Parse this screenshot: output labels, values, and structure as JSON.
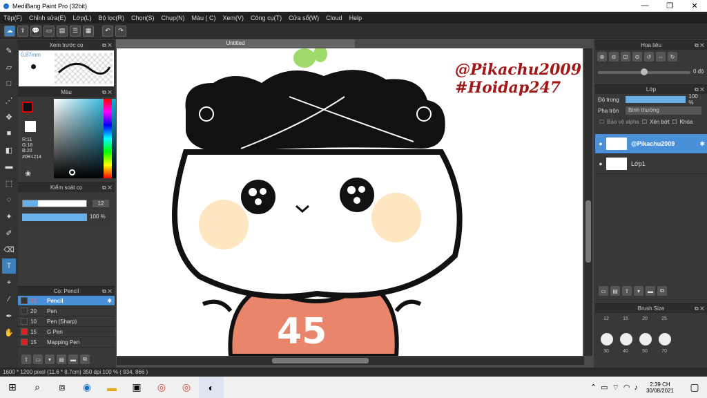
{
  "window": {
    "title": "MediBang Paint Pro (32bit)",
    "minimize": "—",
    "maximize": "❐",
    "close": "✕"
  },
  "menu": [
    "Tệp(F)",
    "Chỉnh sửa(E)",
    "Lớp(L)",
    "Bộ lọc(R)",
    "Chọn(S)",
    "Chụp(N)",
    "Màu ( C)",
    "Xem(V)",
    "Công cụ(T)",
    "Cửa sổ(W)",
    "Cloud",
    "Help"
  ],
  "panels": {
    "brush_preview": {
      "title": "Xem trước cọ",
      "size": "0.87mm"
    },
    "color": {
      "title": "Màu",
      "r": "R:11",
      "g": "G:18",
      "b": "B:20",
      "hex": "#0B1214"
    },
    "control": {
      "title": "Kiểm soát cọ",
      "size_value": "12",
      "opacity_value": "100 %"
    },
    "brush_list": {
      "title": "Cọ: Pencil",
      "items": [
        {
          "size": "12",
          "name": "Pencil",
          "color": "#333333",
          "selected": true
        },
        {
          "size": "20",
          "name": "Pen",
          "color": "#333333"
        },
        {
          "size": "10",
          "name": "Pen (Sharp)",
          "color": "#333333"
        },
        {
          "size": "15",
          "name": "G Pen",
          "color": "#e02020"
        },
        {
          "size": "15",
          "name": "Mapping Pen",
          "color": "#e02020"
        }
      ]
    },
    "navigator": {
      "title": "Hoa tiêu",
      "angle": "0 độ"
    },
    "layer": {
      "title": "Lớp",
      "opacity_label": "Độ trong",
      "opacity_value": "100 %",
      "blend_label": "Pha trộn",
      "blend_value": "Bình thường",
      "protect_alpha": "Bảo vệ alpha",
      "clipping": "Xén bớt",
      "lock": "Khóa",
      "layers": [
        {
          "name": "@Pikachu2009",
          "selected": true
        },
        {
          "name": "Lớp1",
          "selected": false
        }
      ]
    },
    "brush_size": {
      "title": "Brush Size",
      "row1": [
        "12",
        "15",
        "20",
        "25"
      ],
      "row2": [
        "30",
        "40",
        "50",
        "70"
      ]
    }
  },
  "canvas": {
    "tab_title": "Untitled",
    "watermark_line1": "@Pikachu2009",
    "watermark_line2": "#Hoidap247",
    "shirt_number": "45"
  },
  "status": {
    "text": "1600 * 1200 pixel   (11.6 * 8.7cm)   350 dpi   100 %   ( 934, 866 )"
  },
  "taskbar": {
    "time": "2:39 CH",
    "date": "30/08/2021"
  },
  "colors": {
    "accent": "#4a90d9",
    "watermark": "#a01818",
    "shirt": "#e8856a",
    "blush": "#fde6c0"
  }
}
